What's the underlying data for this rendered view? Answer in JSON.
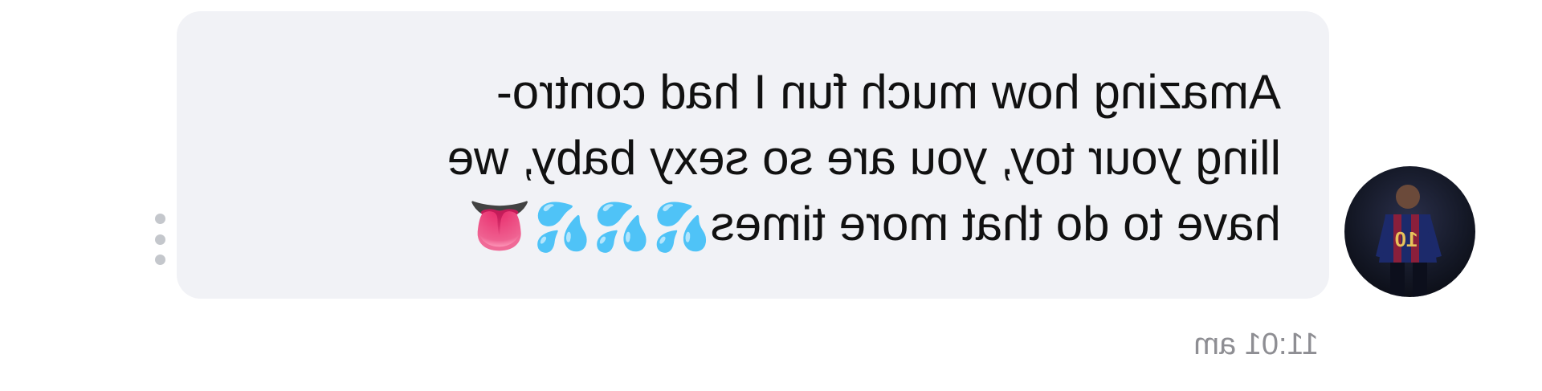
{
  "view": {
    "mirrored": true
  },
  "message": {
    "text": "Amazing how much fun I had contro-\nlling your toy, you are so sexy baby, we\nhave to do that more times",
    "emoji_drops": "💦💦💦",
    "emoji_tongue": "👅",
    "timestamp": "11:01 am"
  },
  "sender": {
    "avatar_icon": "person-avatar-icon",
    "jersey_number": "10"
  },
  "actions": {
    "more_icon": "vertical-ellipsis-icon"
  },
  "colors": {
    "bubble_bg": "#f1f2f6",
    "text": "#111111",
    "timestamp": "#8e8e93",
    "menu_dots": "#c4c7cc"
  }
}
